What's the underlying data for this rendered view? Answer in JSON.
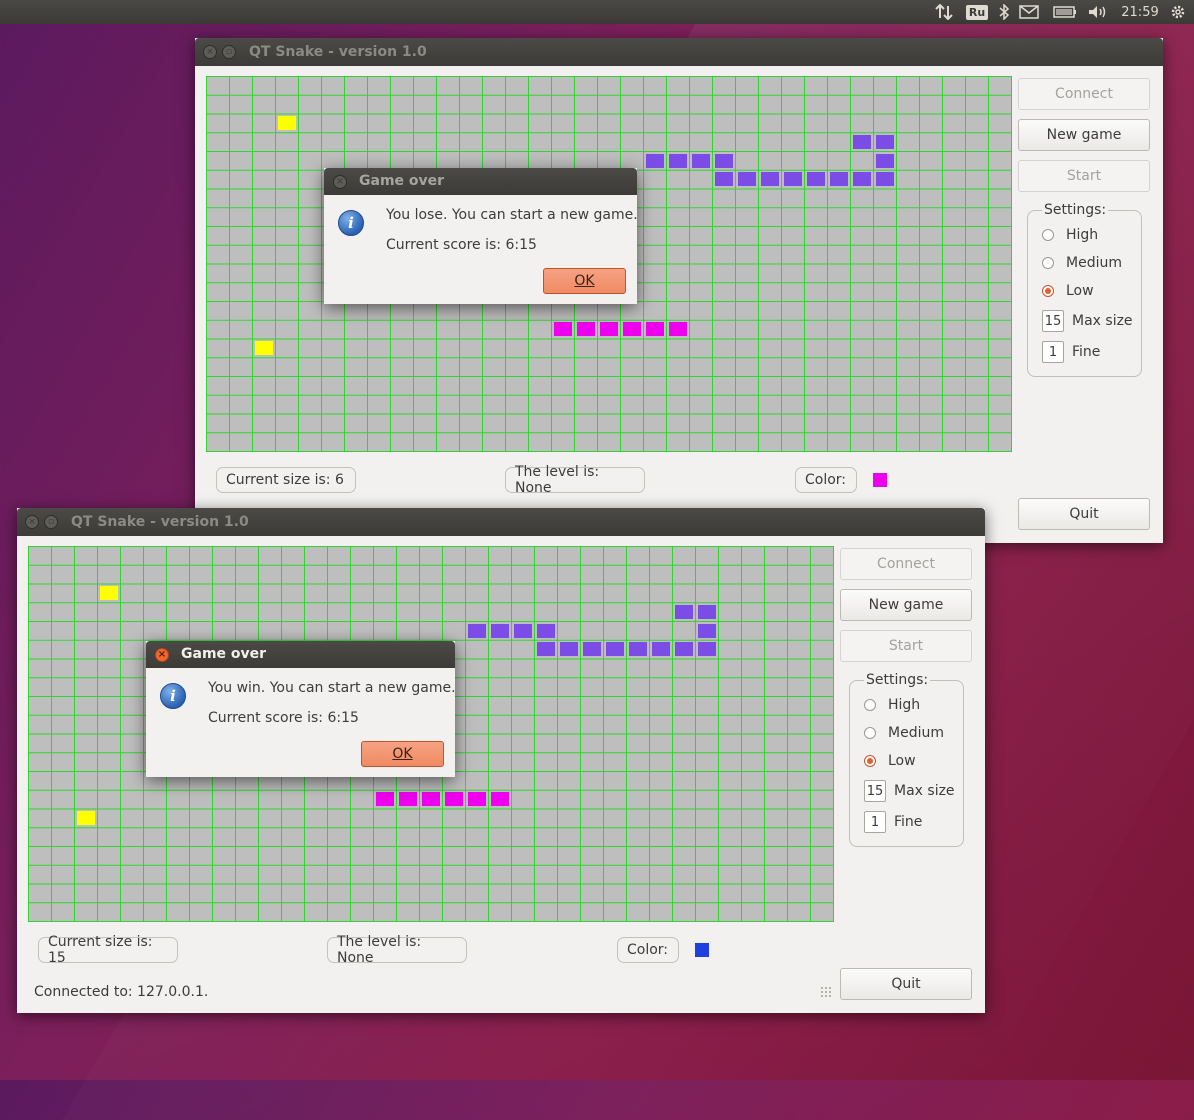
{
  "top_panel": {
    "keyboard_layout": "Ru",
    "clock": "21:59",
    "icons": [
      "network-arrows-icon",
      "keyboard-layout-icon",
      "bluetooth-icon",
      "mail-icon",
      "battery-icon",
      "volume-icon",
      "gear-icon"
    ]
  },
  "colors": {
    "food": "#ffff00",
    "snake_purple": "#7b4de6",
    "snake_magenta": "#ee00ee",
    "grid_line": "#2fd62f",
    "board_bg": "#bebebe",
    "swatch_top": "#ee00ee",
    "swatch_bottom": "#1f3fe0"
  },
  "window_top": {
    "title": "QT Snake - version 1.0",
    "buttons": {
      "connect": "Connect",
      "new_game": "New game",
      "start": "Start",
      "quit": "Quit"
    },
    "settings": {
      "title": "Settings:",
      "high": "High",
      "medium": "Medium",
      "low": "Low",
      "selected": "Low",
      "max_size_value": "15",
      "max_size_label": "Max size",
      "fine_value": "1",
      "fine_label": "Fine"
    },
    "current_size": "Current size is: 6",
    "level": "The level is: None",
    "color_label": "Color:",
    "dialog": {
      "title": "Game over",
      "message": "You lose. You can start a new game.",
      "score": "Current score is: 6:15",
      "ok": "OK"
    }
  },
  "window_bottom": {
    "title": "QT Snake - version 1.0",
    "buttons": {
      "connect": "Connect",
      "new_game": "New game",
      "start": "Start",
      "quit": "Quit"
    },
    "settings": {
      "title": "Settings:",
      "high": "High",
      "medium": "Medium",
      "low": "Low",
      "selected": "Low",
      "max_size_value": "15",
      "max_size_label": "Max size",
      "fine_value": "1",
      "fine_label": "Fine"
    },
    "current_size": "Current size is: 15",
    "level": "The level is: None",
    "color_label": "Color:",
    "status": "Connected to: 127.0.0.1.",
    "dialog": {
      "title": "Game over",
      "message": "You win. You can start a new game.",
      "score": "Current score is: 6:15",
      "ok": "OK"
    }
  }
}
